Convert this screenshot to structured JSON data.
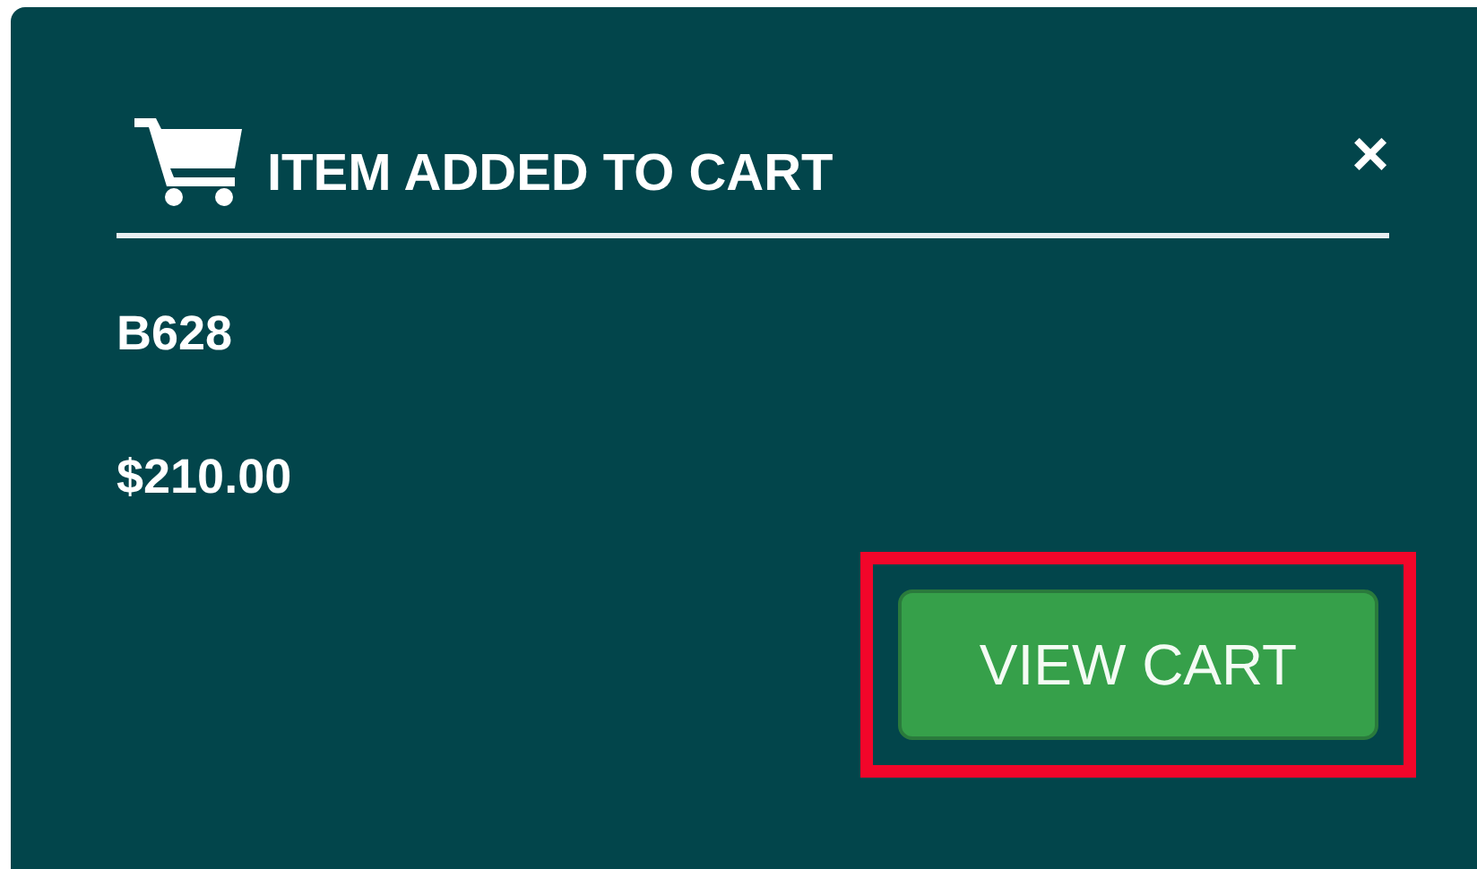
{
  "popup": {
    "title": "ITEM ADDED TO CART",
    "close": "×",
    "product": "B628",
    "price": "$210.00",
    "button": {
      "label": "VIEW CART",
      "highlighted": true
    }
  }
}
